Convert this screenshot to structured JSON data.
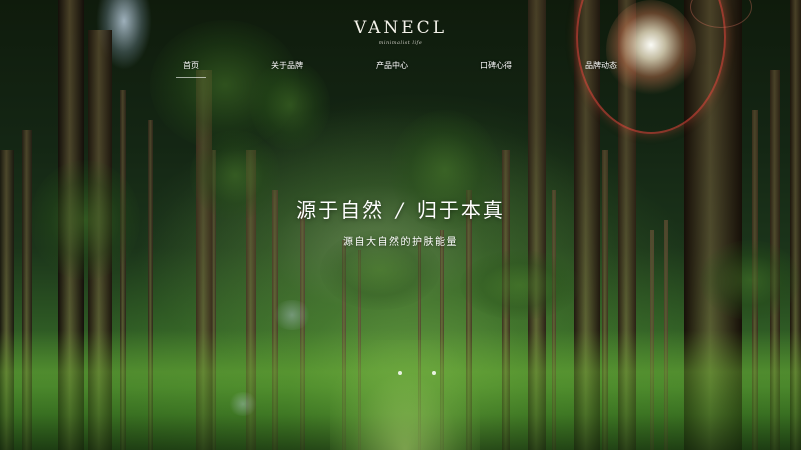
{
  "brand": {
    "logo": "VANECL",
    "tagline": "minimalist life"
  },
  "nav": {
    "items": [
      {
        "label": "首页",
        "active": true
      },
      {
        "label": "关于品牌",
        "active": false
      },
      {
        "label": "产品中心",
        "active": false
      },
      {
        "label": "口碑心得",
        "active": false
      },
      {
        "label": "品牌动态",
        "active": false
      }
    ]
  },
  "hero": {
    "title_left": "源于自然",
    "separator": "/",
    "title_right": "归于本真",
    "subtitle": "源自大自然的护肤能量",
    "slide_count": 2,
    "active_slide": 1
  },
  "colors": {
    "text": "#ffffff",
    "forest_dark": "#0f1b0c",
    "grass": "#3f7a2d",
    "flare": "#eb463c"
  }
}
